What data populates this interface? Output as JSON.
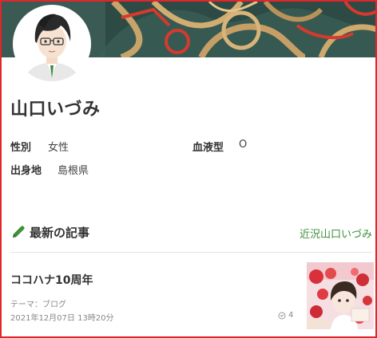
{
  "profile": {
    "name": "山口いづみ",
    "fields": [
      {
        "label": "性別",
        "value": "女性"
      },
      {
        "label": "血液型",
        "value": "O"
      },
      {
        "label": "出身地",
        "value": "島根県"
      }
    ]
  },
  "latest": {
    "heading": "最新の記事",
    "more_link": "近況山口いづみ",
    "articles": [
      {
        "title": "ココハナ10周年",
        "theme": "テーマ：ブログ",
        "date": "2021年12月07日 13時20分",
        "likes": "4"
      }
    ]
  },
  "icons": {
    "section": "pencil-icon",
    "likes": "heart-outline-icon"
  },
  "colors": {
    "frame_border": "#e0262a",
    "link": "#3f8f3b",
    "pencil": "#3f8f3b"
  }
}
